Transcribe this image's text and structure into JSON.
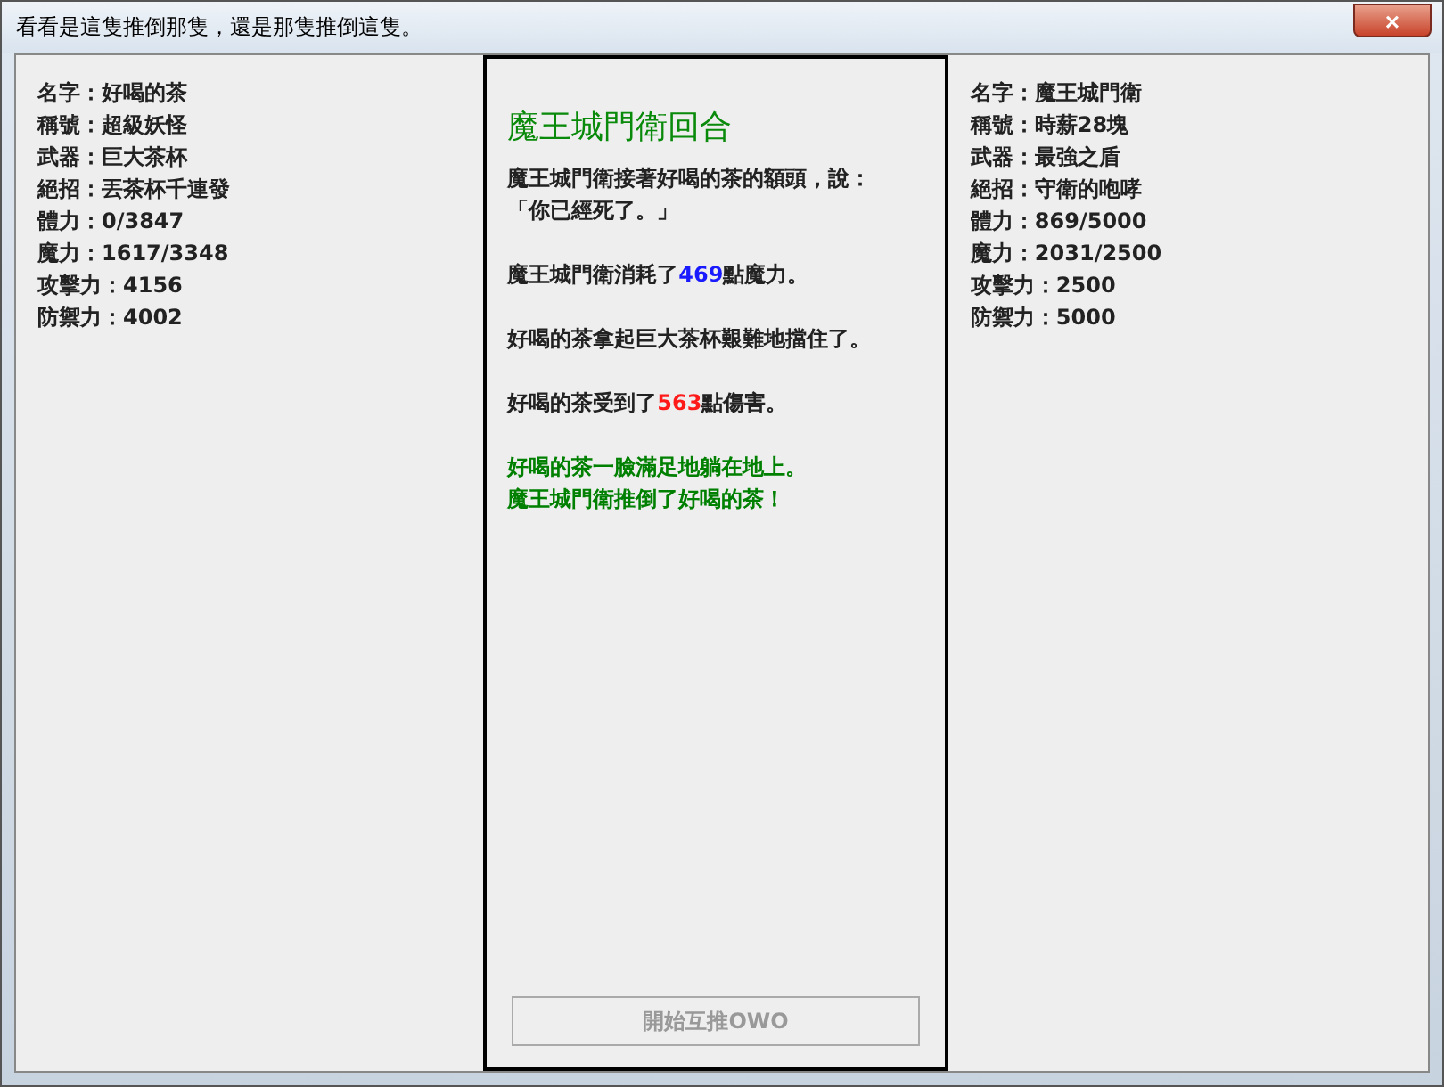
{
  "window": {
    "title": "看看是這隻推倒那隻，還是那隻推倒這隻。",
    "close": "×"
  },
  "left_panel": {
    "stats": [
      {
        "label": "名字：",
        "value": "好喝的茶"
      },
      {
        "label": "稱號：",
        "value": "超級妖怪"
      },
      {
        "label": "武器：",
        "value": "巨大茶杯"
      },
      {
        "label": "絕招：",
        "value": "丟茶杯千連發"
      },
      {
        "label": "體力：",
        "value": "0/3847"
      },
      {
        "label": "魔力：",
        "value": "1617/3348"
      },
      {
        "label": "攻擊力：",
        "value": "4156"
      },
      {
        "label": "防禦力：",
        "value": "4002"
      }
    ]
  },
  "battle_log": {
    "heading": "魔王城門衛回合",
    "paragraphs": [
      {
        "kind": "plain",
        "lines": [
          [
            {
              "text": "魔王城門衛接著好喝的茶的額頭，說：",
              "kind": "text"
            }
          ],
          [
            {
              "text": "「你已經死了。」",
              "kind": "text"
            }
          ]
        ]
      },
      {
        "kind": "plain",
        "lines": [
          [
            {
              "text": "魔王城門衛消耗了",
              "kind": "text"
            },
            {
              "text": "469",
              "kind": "mana"
            },
            {
              "text": "點魔力。",
              "kind": "text"
            }
          ]
        ]
      },
      {
        "kind": "plain",
        "lines": [
          [
            {
              "text": "好喝的茶拿起巨大茶杯艱難地擋住了。",
              "kind": "text"
            }
          ]
        ]
      },
      {
        "kind": "plain",
        "lines": [
          [
            {
              "text": "好喝的茶受到了",
              "kind": "text"
            },
            {
              "text": "563",
              "kind": "damage"
            },
            {
              "text": "點傷害。",
              "kind": "text"
            }
          ]
        ]
      },
      {
        "kind": "result",
        "lines": [
          [
            {
              "text": "好喝的茶一臉滿足地躺在地上。",
              "kind": "text"
            }
          ],
          [
            {
              "text": "魔王城門衛推倒了好喝的茶！",
              "kind": "text"
            }
          ]
        ]
      }
    ],
    "button": {
      "label": "開始互推OWO",
      "disabled": true
    }
  },
  "right_panel": {
    "stats": [
      {
        "label": "名字：",
        "value": "魔王城門衛"
      },
      {
        "label": "稱號：",
        "value": "時薪28塊"
      },
      {
        "label": "武器：",
        "value": "最強之盾"
      },
      {
        "label": "絕招：",
        "value": "守衛的咆哮"
      },
      {
        "label": "體力：",
        "value": "869/5000"
      },
      {
        "label": "魔力：",
        "value": "2031/2500"
      },
      {
        "label": "攻擊力：",
        "value": "2500"
      },
      {
        "label": "防禦力：",
        "value": "5000"
      }
    ]
  }
}
